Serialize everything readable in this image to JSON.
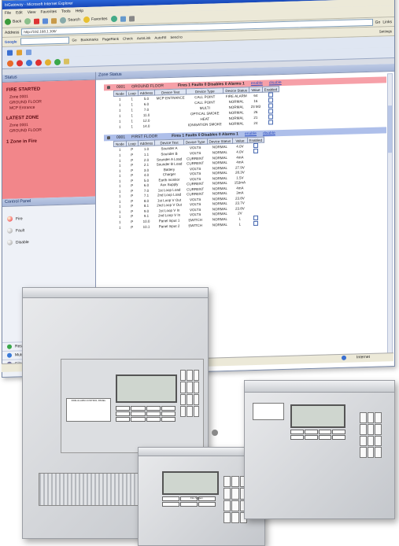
{
  "window": {
    "title": "biGateway - Microsoft Internet Explorer",
    "menu": [
      "File",
      "Edit",
      "View",
      "Favorites",
      "Tools",
      "Help"
    ],
    "toolbar": {
      "back": "Back",
      "search": "Search",
      "favorites": "Favorites"
    },
    "address": {
      "label": "Address",
      "value": "http://192.168.1.100/",
      "go": "Go",
      "links": "Links"
    },
    "google_bar": {
      "logo": "Google",
      "settings": "Settings",
      "items": [
        "Go",
        "Bookmarks",
        "PageRank",
        "Check",
        "AutoLink",
        "AutoFill",
        "Send to"
      ]
    },
    "status": {
      "internet": "Internet"
    },
    "colors": {
      "title": "#1747b8",
      "alarm": "#f2868a",
      "zone_fire": "#f6a0a8",
      "zone_normal": "#aebfea"
    }
  },
  "status_panel": {
    "header": "Status",
    "fire_started": "FIRE STARTED",
    "fire_lines": [
      "Zone 0001",
      "GROUND FLOOR",
      "MCP Entrance"
    ],
    "latest_zone": "LATEST ZONE",
    "latest_lines": [
      "Zone 0001",
      "GROUND FLOOR"
    ],
    "zones_in_fire": "1 Zone in Fire"
  },
  "control_panel": {
    "header": "Control Panel",
    "items": [
      {
        "label": "Fire",
        "icon": "red-led-icon"
      },
      {
        "label": "Fault",
        "icon": "led-icon"
      },
      {
        "label": "Disable",
        "icon": "led-icon"
      }
    ],
    "buttons": [
      {
        "label": "Reset",
        "icon": "reset-icon"
      },
      {
        "label": "Mute",
        "icon": "mute-icon"
      },
      {
        "label": "Silence Alarms",
        "icon": "silence-icon"
      }
    ]
  },
  "zone_status": {
    "header": "Zone Status",
    "zones": [
      {
        "code": "0001",
        "name": "GROUND FLOOR",
        "summary": "Fires 1 Faults 0 Disables 0 Alarms 1",
        "enable": "enable",
        "disable": "disable",
        "columns": [
          "Node",
          "Loop",
          "Address",
          "Device Text",
          "Device Type",
          "Device Status",
          "Value",
          "Enabled"
        ],
        "rows": [
          [
            "1",
            "1",
            "5.0",
            "MCP ENTRANCE",
            "CALL POINT",
            "FIRE ALARM",
            "64",
            ""
          ],
          [
            "1",
            "1",
            "6.0",
            "",
            "CALL POINT",
            "NORMAL",
            "16",
            ""
          ],
          [
            "1",
            "1",
            "7.0",
            "",
            "MULTI",
            "NORMAL",
            "23 M3",
            ""
          ],
          [
            "1",
            "1",
            "11.0",
            "",
            "OPTICAL SMOKE",
            "NORMAL",
            "26",
            ""
          ],
          [
            "1",
            "1",
            "12.0",
            "",
            "HEAT",
            "NORMAL",
            "21",
            ""
          ],
          [
            "1",
            "1",
            "14.0",
            "",
            "IONISATION SMOKE",
            "NORMAL",
            "24",
            ""
          ]
        ]
      },
      {
        "code": "0001",
        "name": "FIRST FLOOR",
        "summary": "Fires 1 Faults 0 Disables 0 Alarms 1",
        "enable": "enable",
        "disable": "disable",
        "columns": [
          "Node",
          "Loop",
          "Address",
          "Device Text",
          "Device Type",
          "Device Status",
          "Value",
          "Enabled"
        ],
        "rows": [
          [
            "1",
            "P",
            "1.0",
            "Sounder A",
            "VOLTS",
            "NORMAL",
            "4.0V",
            ""
          ],
          [
            "1",
            "P",
            "1.1",
            "Sounder B",
            "VOLTS",
            "NORMAL",
            "4.0V",
            ""
          ],
          [
            "1",
            "P",
            "2.0",
            "Sounder A Load",
            "CURRENT",
            "NORMAL",
            "4mA",
            ""
          ],
          [
            "1",
            "P",
            "2.1",
            "Sounder B Load",
            "CURRENT",
            "NORMAL",
            "4mA",
            ""
          ],
          [
            "1",
            "P",
            "3.0",
            "Battery",
            "VOLTS",
            "NORMAL",
            "27.9V",
            ""
          ],
          [
            "1",
            "P",
            "4.0",
            "Charger",
            "VOLTS",
            "NORMAL",
            "28.3V",
            ""
          ],
          [
            "1",
            "P",
            "5.0",
            "Earth monitor",
            "VOLTS",
            "NORMAL",
            "1.5V",
            ""
          ],
          [
            "1",
            "P",
            "6.0",
            "Aux Supply",
            "CURRENT",
            "NORMAL",
            "153mA",
            ""
          ],
          [
            "1",
            "P",
            "7.0",
            "1st Loop Load",
            "CURRENT",
            "NORMAL",
            "4mA",
            ""
          ],
          [
            "1",
            "P",
            "7.1",
            "2nd Loop Load",
            "CURRENT",
            "NORMAL",
            "3mA",
            ""
          ],
          [
            "1",
            "P",
            "8.0",
            "1st Loop V Out",
            "VOLTS",
            "NORMAL",
            "23.8V",
            ""
          ],
          [
            "1",
            "P",
            "8.1",
            "2nd Loop V Out",
            "VOLTS",
            "NORMAL",
            "23.7V",
            ""
          ],
          [
            "1",
            "P",
            "9.0",
            "1st Loop V In",
            "VOLTS",
            "NORMAL",
            "23.8V",
            ""
          ],
          [
            "1",
            "P",
            "9.1",
            "2nd Loop V In",
            "VOLTS",
            "NORMAL",
            "2V",
            ""
          ],
          [
            "1",
            "P",
            "10.0",
            "Panel Input 1",
            "SWITCH",
            "NORMAL",
            "L",
            ""
          ],
          [
            "1",
            "P",
            "10.1",
            "Panel Input 2",
            "SWITCH",
            "NORMAL",
            "L",
            ""
          ]
        ]
      }
    ]
  },
  "hardware": {
    "large_panel_label": "FIRE ALARM CONTROL PANEL",
    "small_panel_label": "Fire System"
  }
}
